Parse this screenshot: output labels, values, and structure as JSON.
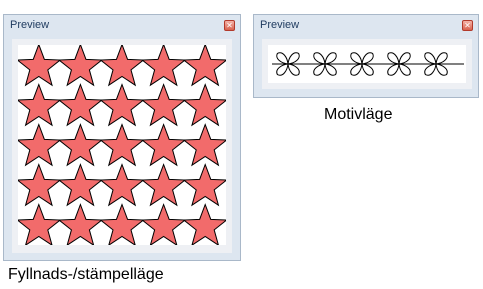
{
  "fill_panel": {
    "title": "Preview",
    "close_icon": "close-icon",
    "star_fill": "#f26b6b",
    "star_stroke": "#000000",
    "grid": {
      "rows": 5,
      "cols": 5
    }
  },
  "motif_panel": {
    "title": "Preview",
    "close_icon": "close-icon",
    "motif_count": 5,
    "line_color": "#000000"
  },
  "captions": {
    "motif": "Motivläge",
    "fill": "Fyllnads-/stämpelläge"
  }
}
